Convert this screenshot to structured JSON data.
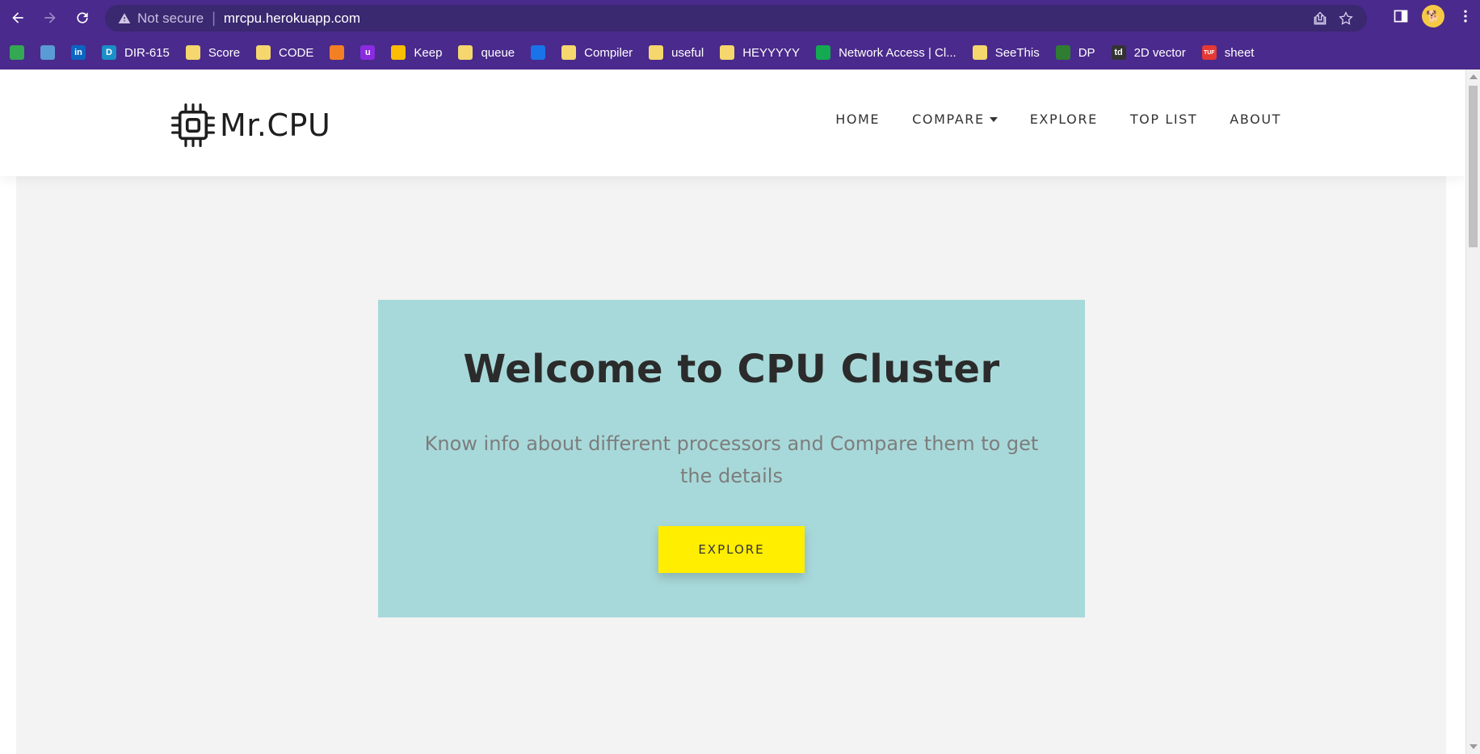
{
  "browser": {
    "address": {
      "security_label": "Not secure",
      "separator": "|",
      "url": "mrcpu.herokuapp.com"
    },
    "bookmarks": [
      {
        "label": "",
        "icon": "drive-icon",
        "color": "#34a853"
      },
      {
        "label": "",
        "icon": "cloud-icon",
        "color": "#5b9bd5"
      },
      {
        "label": "",
        "icon": "linkedin-icon",
        "color": "#0a66c2",
        "glyph": "in"
      },
      {
        "label": "DIR-615",
        "icon": "dlink-icon",
        "color": "#1a8fc8",
        "glyph": "D"
      },
      {
        "label": "Score",
        "icon": "folder-icon"
      },
      {
        "label": "CODE",
        "icon": "folder-icon"
      },
      {
        "label": "",
        "icon": "stackoverflow-icon",
        "color": "#f48024"
      },
      {
        "label": "",
        "icon": "unstop-icon",
        "color": "#8a2be2",
        "glyph": "u"
      },
      {
        "label": "Keep",
        "icon": "keep-icon",
        "color": "#fbbc04"
      },
      {
        "label": "queue",
        "icon": "folder-icon"
      },
      {
        "label": "",
        "icon": "phone-icon",
        "color": "#1a73e8"
      },
      {
        "label": "Compiler",
        "icon": "folder-icon"
      },
      {
        "label": "useful",
        "icon": "folder-icon"
      },
      {
        "label": "HEYYYYY",
        "icon": "folder-icon"
      },
      {
        "label": "Network Access | Cl...",
        "icon": "mongodb-icon",
        "color": "#13aa52"
      },
      {
        "label": "SeeThis",
        "icon": "folder-icon"
      },
      {
        "label": "DP",
        "icon": "dp-icon",
        "color": "#2e7d32"
      },
      {
        "label": "2D vector",
        "icon": "td-icon",
        "color": "#333333",
        "glyph": "td"
      },
      {
        "label": "sheet",
        "icon": "tuf-icon",
        "color": "#e53935",
        "glyph": "TUF"
      }
    ]
  },
  "site": {
    "logo_text": "Mr.CPU",
    "nav": [
      {
        "label": "HOME"
      },
      {
        "label": "COMPARE",
        "dropdown": true
      },
      {
        "label": "EXPLORE"
      },
      {
        "label": "TOP LIST"
      },
      {
        "label": "ABOUT"
      }
    ]
  },
  "hero": {
    "title": "Welcome to CPU Cluster",
    "subtitle": "Know info about different processors and Compare them to get the details",
    "button_label": "EXPLORE",
    "background": "#a8d9da",
    "button_color": "#ffee00"
  },
  "theme": {
    "browser_frame": "#4a2a8c",
    "omnibox": "#3a2870"
  }
}
